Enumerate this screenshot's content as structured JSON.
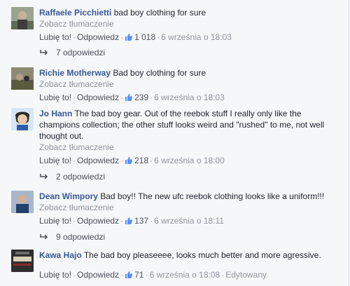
{
  "labels": {
    "translate": "Zobacz tłumaczenie",
    "like": "Lubię to!",
    "reply": "Odpowiedz",
    "edited": "Edytowany"
  },
  "comments": [
    {
      "author": "Raffaele Picchietti",
      "text": "bad boy clothing for sure",
      "likes": "1 018",
      "time": "6 września o 18:03",
      "replies": "7 odpowiedzi",
      "avatar_color": "#7a8a6a"
    },
    {
      "author": "Richie Motherway",
      "text": "Bad boy clothing for sure",
      "likes": "239",
      "time": "6 września o 18:03",
      "avatar_color": "#6b6a55"
    },
    {
      "author": "Jo Hann",
      "text": "The bad boy gear. Out of the reebok stuff I really only like the champions collection; the other stuff looks weird and \"rushed\" to me, not well thought out.",
      "likes": "218",
      "time": "6 września o 18:00",
      "replies": "2 odpowiedzi",
      "avatar_color": "#3f6fb5"
    },
    {
      "author": "Dean Wimpory",
      "text": "Bad boy!! The new ufc reebok clothing looks like a uniform!!!",
      "likes": "137",
      "time": "6 września o 18:11",
      "replies": "9 odpowiedzi",
      "avatar_color": "#54709c"
    },
    {
      "author": "Kawa Hajo",
      "text": "The bad boy pleaseeee, looks much better and more agressive.",
      "likes": "71",
      "time": "6 września o 18:08",
      "edited": true,
      "avatar_color": "#3a3a3a"
    }
  ],
  "colors": {
    "link": "#365899",
    "meta": "#90949c",
    "like_icon": "#5890ff"
  }
}
